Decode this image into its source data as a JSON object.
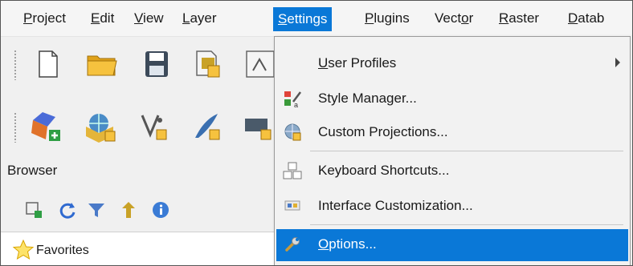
{
  "menubar": {
    "items": [
      {
        "label": "Project",
        "u": "P",
        "rest": "roject"
      },
      {
        "label": "Edit",
        "u": "E",
        "rest": "dit"
      },
      {
        "label": "View",
        "u": "V",
        "rest": "iew"
      },
      {
        "label": "Layer",
        "u": "L",
        "rest": "ayer"
      },
      {
        "label": "Settings",
        "u": "S",
        "rest": "ettings"
      },
      {
        "label": "Plugins",
        "u": "P",
        "rest": "lugins"
      },
      {
        "label": "Vector",
        "pre": "Vect",
        "u": "o",
        "rest": "r"
      },
      {
        "label": "Raster",
        "u": "R",
        "rest": "aster"
      },
      {
        "label": "Datab",
        "u": "D",
        "rest": "atab"
      }
    ]
  },
  "browser": {
    "title": "Browser",
    "tree": [
      {
        "label": "Favorites"
      }
    ]
  },
  "settings_menu": {
    "items": [
      {
        "label": "User Profiles",
        "u": "U",
        "rest": "ser Profiles",
        "has_submenu": true
      },
      {
        "label": "Style Manager..."
      },
      {
        "label": "Custom Projections..."
      },
      {
        "label": "Keyboard Shortcuts..."
      },
      {
        "label": "Interface Customization..."
      },
      {
        "label": "Options...",
        "u": "O",
        "rest": "ptions...",
        "selected": true
      }
    ]
  },
  "colors": {
    "selection": "#0a78d7",
    "menu_bg": "#f2f2f2",
    "toolbar_bg": "#f0f0f0"
  }
}
